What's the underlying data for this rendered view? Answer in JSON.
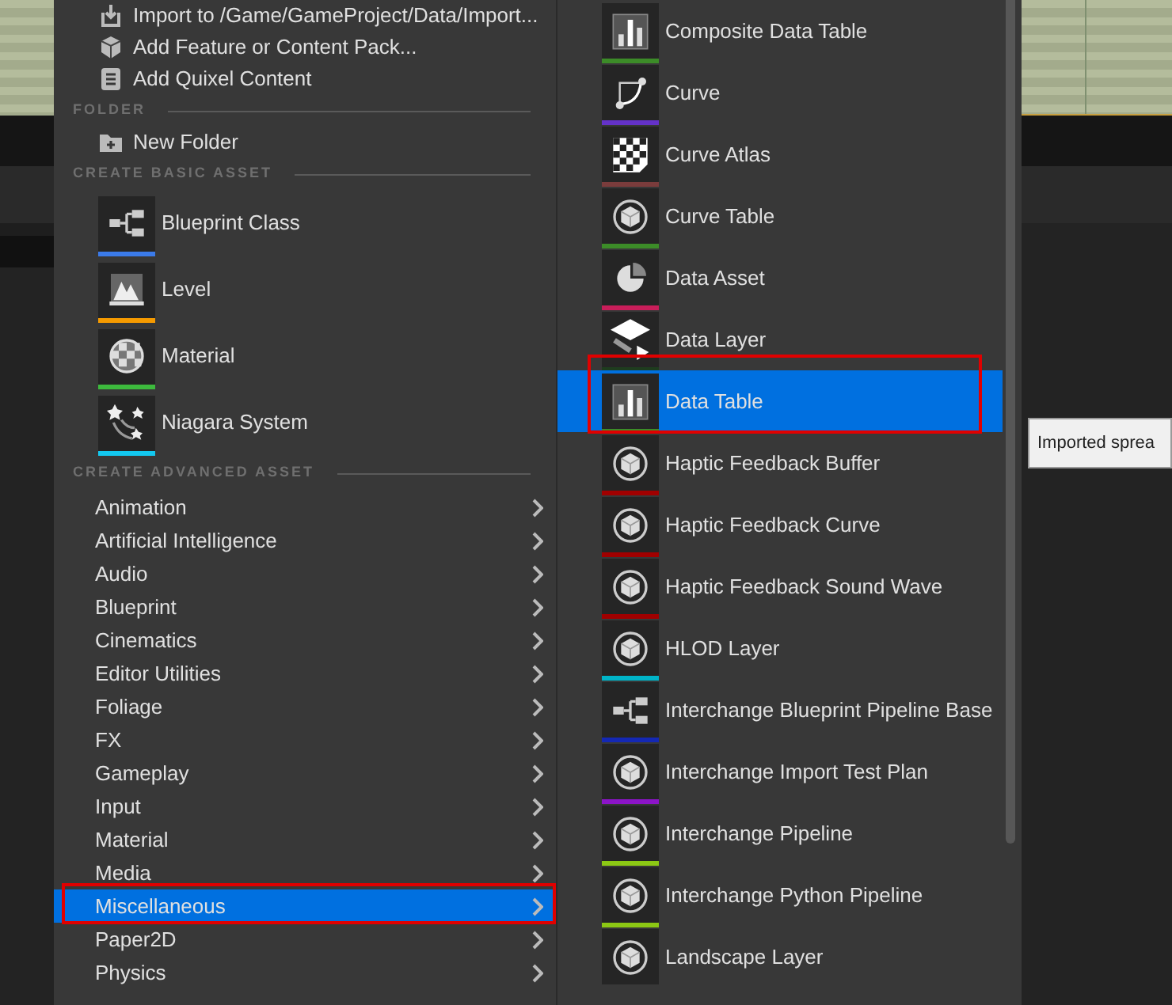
{
  "menu": {
    "top_items": [
      {
        "label": "Import to /Game/GameProject/Data/Import...",
        "kind": "import"
      },
      {
        "label": "Add Feature or Content Pack...",
        "kind": "package"
      },
      {
        "label": "Add Quixel Content",
        "kind": "quixel"
      }
    ],
    "folder_header": "FOLDER",
    "folder_items": [
      {
        "label": "New Folder",
        "kind": "folder"
      }
    ],
    "basic_header": "CREATE BASIC ASSET",
    "basic_assets": [
      {
        "label": "Blueprint Class",
        "kind": "blueprint",
        "color": "#3b7bea"
      },
      {
        "label": "Level",
        "kind": "level",
        "color": "#f59a00"
      },
      {
        "label": "Material",
        "kind": "material",
        "color": "#3dba3d"
      },
      {
        "label": "Niagara System",
        "kind": "niagara",
        "color": "#13c8f0"
      }
    ],
    "advanced_header": "CREATE ADVANCED ASSET",
    "categories": [
      {
        "label": "Animation",
        "selected": false,
        "outlined": false
      },
      {
        "label": "Artificial Intelligence",
        "selected": false,
        "outlined": false
      },
      {
        "label": "Audio",
        "selected": false,
        "outlined": false
      },
      {
        "label": "Blueprint",
        "selected": false,
        "outlined": false
      },
      {
        "label": "Cinematics",
        "selected": false,
        "outlined": false
      },
      {
        "label": "Editor Utilities",
        "selected": false,
        "outlined": false
      },
      {
        "label": "Foliage",
        "selected": false,
        "outlined": false
      },
      {
        "label": "FX",
        "selected": false,
        "outlined": false
      },
      {
        "label": "Gameplay",
        "selected": false,
        "outlined": false
      },
      {
        "label": "Input",
        "selected": false,
        "outlined": false
      },
      {
        "label": "Material",
        "selected": false,
        "outlined": false
      },
      {
        "label": "Media",
        "selected": false,
        "outlined": false
      },
      {
        "label": "Miscellaneous",
        "selected": true,
        "outlined": true
      },
      {
        "label": "Paper2D",
        "selected": false,
        "outlined": false
      },
      {
        "label": "Physics",
        "selected": false,
        "outlined": false
      }
    ]
  },
  "submenu": {
    "items": [
      {
        "label": "Composite Data Table",
        "kind": "bars",
        "color": "#3c8c28",
        "selected": false,
        "outlined": false
      },
      {
        "label": "Curve",
        "kind": "curve",
        "color": "#6432c8",
        "selected": false,
        "outlined": false
      },
      {
        "label": "Curve Atlas",
        "kind": "checker",
        "color": "#7a3c3c",
        "selected": false,
        "outlined": false
      },
      {
        "label": "Curve Table",
        "kind": "cube",
        "color": "#3c8c28",
        "selected": false,
        "outlined": false
      },
      {
        "label": "Data Asset",
        "kind": "pie",
        "color": "#c81e5a",
        "selected": false,
        "outlined": false
      },
      {
        "label": "Data Layer",
        "kind": "layer",
        "color": "#1e3c1e",
        "selected": false,
        "outlined": false
      },
      {
        "label": "Data Table",
        "kind": "bars",
        "color": "#3c8c28",
        "selected": true,
        "outlined": true
      },
      {
        "label": "Haptic Feedback Buffer",
        "kind": "cube",
        "color": "#a00000",
        "selected": false,
        "outlined": false
      },
      {
        "label": "Haptic Feedback Curve",
        "kind": "cube",
        "color": "#a00000",
        "selected": false,
        "outlined": false
      },
      {
        "label": "Haptic Feedback Sound Wave",
        "kind": "cube",
        "color": "#a00000",
        "selected": false,
        "outlined": false
      },
      {
        "label": "HLOD Layer",
        "kind": "cube",
        "color": "#00b4c8",
        "selected": false,
        "outlined": false
      },
      {
        "label": "Interchange Blueprint Pipeline Base",
        "kind": "blueprint",
        "color": "#1428b4",
        "selected": false,
        "outlined": false
      },
      {
        "label": "Interchange Import Test Plan",
        "kind": "cube",
        "color": "#8c14c8",
        "selected": false,
        "outlined": false
      },
      {
        "label": "Interchange Pipeline",
        "kind": "cube",
        "color": "#8cc814",
        "selected": false,
        "outlined": false
      },
      {
        "label": "Interchange Python Pipeline",
        "kind": "cube",
        "color": "#8cc814",
        "selected": false,
        "outlined": false
      },
      {
        "label": "Landscape Layer",
        "kind": "cube",
        "selected": false,
        "outlined": false
      }
    ]
  },
  "tooltip": {
    "text": "Imported sprea"
  }
}
